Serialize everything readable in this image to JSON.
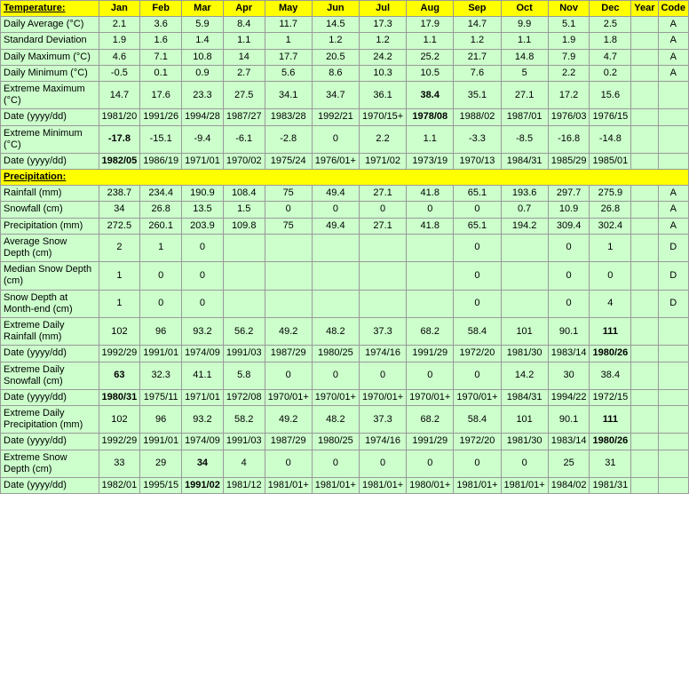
{
  "headers": {
    "row_label": "Temperature:",
    "months": [
      "Jan",
      "Feb",
      "Mar",
      "Apr",
      "May",
      "Jun",
      "Jul",
      "Aug",
      "Sep",
      "Oct",
      "Nov",
      "Dec",
      "Year",
      "Code"
    ]
  },
  "rows": [
    {
      "label": "Daily Average (°C)",
      "values": [
        "2.1",
        "3.6",
        "5.9",
        "8.4",
        "11.7",
        "14.5",
        "17.3",
        "17.9",
        "14.7",
        "9.9",
        "5.1",
        "2.5",
        "",
        "A"
      ],
      "bold_indices": []
    },
    {
      "label": "Standard Deviation",
      "values": [
        "1.9",
        "1.6",
        "1.4",
        "1.1",
        "1",
        "1.2",
        "1.2",
        "1.1",
        "1.2",
        "1.1",
        "1.9",
        "1.8",
        "",
        "A"
      ],
      "bold_indices": []
    },
    {
      "label": "Daily Maximum (°C)",
      "values": [
        "4.6",
        "7.1",
        "10.8",
        "14",
        "17.7",
        "20.5",
        "24.2",
        "25.2",
        "21.7",
        "14.8",
        "7.9",
        "4.7",
        "",
        "A"
      ],
      "bold_indices": []
    },
    {
      "label": "Daily Minimum (°C)",
      "values": [
        "-0.5",
        "0.1",
        "0.9",
        "2.7",
        "5.6",
        "8.6",
        "10.3",
        "10.5",
        "7.6",
        "5",
        "2.2",
        "0.2",
        "",
        "A"
      ],
      "bold_indices": []
    },
    {
      "label": "Extreme Maximum (°C)",
      "values": [
        "14.7",
        "17.6",
        "23.3",
        "27.5",
        "34.1",
        "34.7",
        "36.1",
        "38.4",
        "35.1",
        "27.1",
        "17.2",
        "15.6",
        "",
        ""
      ],
      "bold_indices": [
        7
      ]
    },
    {
      "label": "Date (yyyy/dd)",
      "values": [
        "1981/20",
        "1991/26",
        "1994/28",
        "1987/27",
        "1983/28",
        "1992/21",
        "1970/15+",
        "1978/08",
        "1988/02",
        "1987/01",
        "1976/03",
        "1976/15",
        "",
        ""
      ],
      "bold_indices": [
        7
      ]
    },
    {
      "label": "Extreme Minimum (°C)",
      "values": [
        "-17.8",
        "-15.1",
        "-9.4",
        "-6.1",
        "-2.8",
        "0",
        "2.2",
        "1.1",
        "-3.3",
        "-8.5",
        "-16.8",
        "-14.8",
        "",
        ""
      ],
      "bold_indices": [
        0
      ]
    },
    {
      "label": "Date (yyyy/dd)",
      "values": [
        "1982/05",
        "1986/19",
        "1971/01",
        "1970/02",
        "1975/24",
        "1976/01+",
        "1971/02",
        "1973/19",
        "1970/13",
        "1984/31",
        "1985/29",
        "1985/01",
        "",
        ""
      ],
      "bold_indices": [
        0
      ]
    },
    {
      "section": "Precipitation:",
      "values": []
    },
    {
      "label": "Rainfall (mm)",
      "values": [
        "238.7",
        "234.4",
        "190.9",
        "108.4",
        "75",
        "49.4",
        "27.1",
        "41.8",
        "65.1",
        "193.6",
        "297.7",
        "275.9",
        "",
        "A"
      ],
      "bold_indices": []
    },
    {
      "label": "Snowfall (cm)",
      "values": [
        "34",
        "26.8",
        "13.5",
        "1.5",
        "0",
        "0",
        "0",
        "0",
        "0",
        "0.7",
        "10.9",
        "26.8",
        "",
        "A"
      ],
      "bold_indices": []
    },
    {
      "label": "Precipitation (mm)",
      "values": [
        "272.5",
        "260.1",
        "203.9",
        "109.8",
        "75",
        "49.4",
        "27.1",
        "41.8",
        "65.1",
        "194.2",
        "309.4",
        "302.4",
        "",
        "A"
      ],
      "bold_indices": []
    },
    {
      "label": "Average Snow Depth (cm)",
      "values": [
        "2",
        "1",
        "0",
        "",
        "",
        "",
        "",
        "",
        "0",
        "",
        "0",
        "1",
        "",
        "D"
      ],
      "bold_indices": []
    },
    {
      "label": "Median Snow Depth (cm)",
      "values": [
        "1",
        "0",
        "0",
        "",
        "",
        "",
        "",
        "",
        "0",
        "",
        "0",
        "0",
        "",
        "D"
      ],
      "bold_indices": []
    },
    {
      "label": "Snow Depth at Month-end (cm)",
      "values": [
        "1",
        "0",
        "0",
        "",
        "",
        "",
        "",
        "",
        "0",
        "",
        "0",
        "4",
        "",
        "D"
      ],
      "bold_indices": []
    },
    {
      "label": "Extreme Daily Rainfall (mm)",
      "values": [
        "102",
        "96",
        "93.2",
        "56.2",
        "49.2",
        "48.2",
        "37.3",
        "68.2",
        "58.4",
        "101",
        "90.1",
        "111",
        "",
        ""
      ],
      "bold_indices": [
        11
      ]
    },
    {
      "label": "Date (yyyy/dd)",
      "values": [
        "1992/29",
        "1991/01",
        "1974/09",
        "1991/03",
        "1987/29",
        "1980/25",
        "1974/16",
        "1991/29",
        "1972/20",
        "1981/30",
        "1983/14",
        "1980/26",
        "",
        ""
      ],
      "bold_indices": [
        11
      ]
    },
    {
      "label": "Extreme Daily Snowfall (cm)",
      "values": [
        "63",
        "32.3",
        "41.1",
        "5.8",
        "0",
        "0",
        "0",
        "0",
        "0",
        "14.2",
        "30",
        "38.4",
        "",
        ""
      ],
      "bold_indices": [
        0
      ]
    },
    {
      "label": "Date (yyyy/dd)",
      "values": [
        "1980/31",
        "1975/11",
        "1971/01",
        "1972/08",
        "1970/01+",
        "1970/01+",
        "1970/01+",
        "1970/01+",
        "1970/01+",
        "1984/31",
        "1994/22",
        "1972/15",
        "",
        ""
      ],
      "bold_indices": [
        0
      ]
    },
    {
      "label": "Extreme Daily Precipitation (mm)",
      "values": [
        "102",
        "96",
        "93.2",
        "58.2",
        "49.2",
        "48.2",
        "37.3",
        "68.2",
        "58.4",
        "101",
        "90.1",
        "111",
        "",
        ""
      ],
      "bold_indices": [
        11
      ]
    },
    {
      "label": "Date (yyyy/dd)",
      "values": [
        "1992/29",
        "1991/01",
        "1974/09",
        "1991/03",
        "1987/29",
        "1980/25",
        "1974/16",
        "1991/29",
        "1972/20",
        "1981/30",
        "1983/14",
        "1980/26",
        "",
        ""
      ],
      "bold_indices": [
        11
      ]
    },
    {
      "label": "Extreme Snow Depth (cm)",
      "values": [
        "33",
        "29",
        "34",
        "4",
        "0",
        "0",
        "0",
        "0",
        "0",
        "0",
        "25",
        "31",
        "",
        ""
      ],
      "bold_indices": [
        2
      ]
    },
    {
      "label": "Date (yyyy/dd)",
      "values": [
        "1982/01",
        "1995/15",
        "1991/02",
        "1981/12",
        "1981/01+",
        "1981/01+",
        "1981/01+",
        "1980/01+",
        "1981/01+",
        "1981/01+",
        "1984/02",
        "1981/31",
        "",
        ""
      ],
      "bold_indices": [
        2
      ]
    }
  ]
}
